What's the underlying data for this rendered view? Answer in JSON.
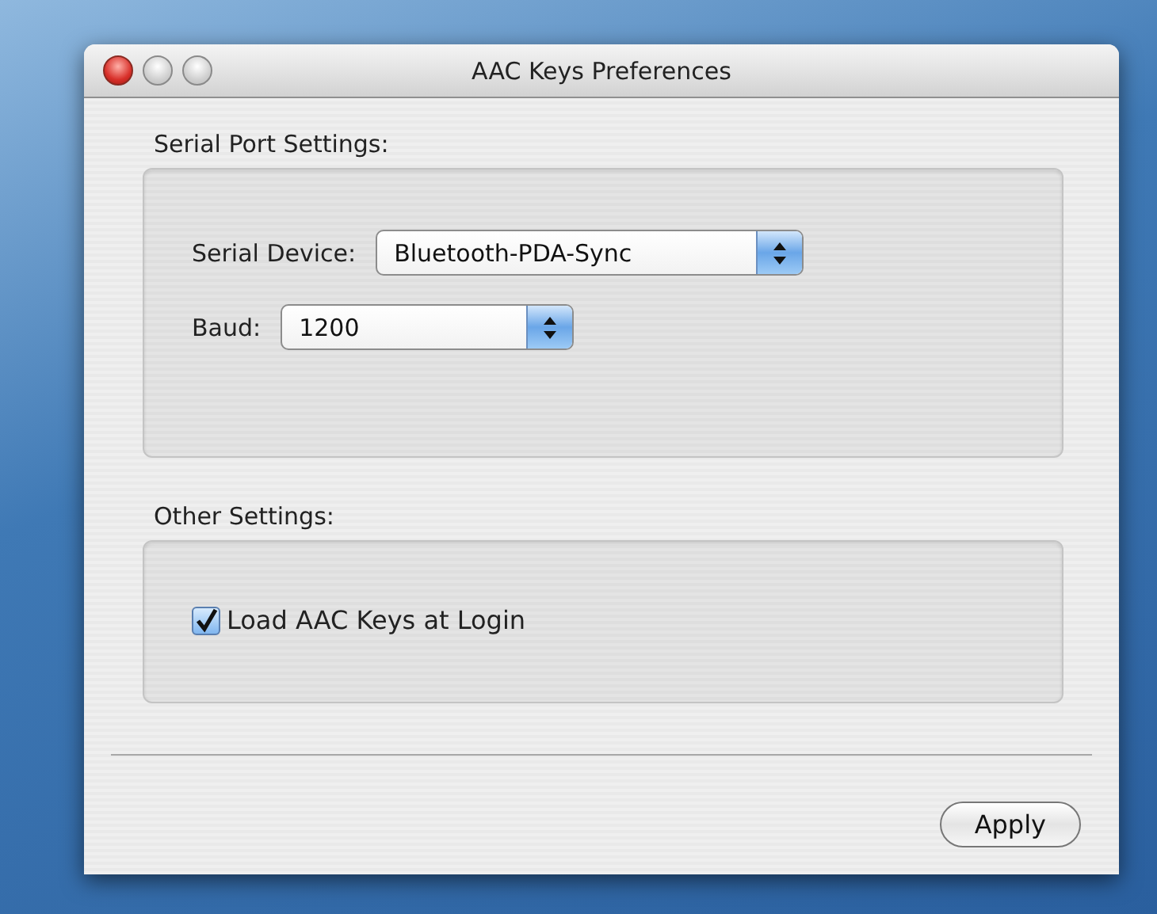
{
  "window": {
    "title": "AAC Keys Preferences"
  },
  "serial_port_settings": {
    "heading": "Serial Port Settings:",
    "fields": [
      {
        "label": "Serial Device:",
        "value": "Bluetooth-PDA-Sync"
      },
      {
        "label": "Baud:",
        "value": "1200"
      }
    ]
  },
  "other_settings": {
    "heading": "Other Settings:",
    "checkboxes": [
      {
        "label": "Load AAC Keys at Login",
        "checked": true
      }
    ]
  },
  "buttons": [
    "Apply"
  ]
}
